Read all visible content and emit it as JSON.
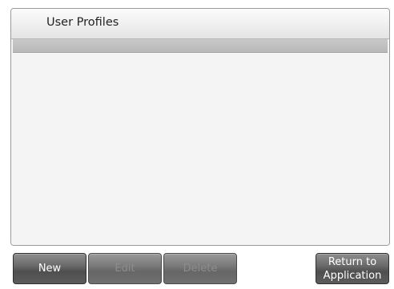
{
  "window": {
    "title": "User Profiles"
  },
  "buttons": {
    "new_label": "New",
    "edit_label": "Edit",
    "delete_label": "Delete",
    "return_label_line1": "Return to",
    "return_label_line2": "Application"
  },
  "state": {
    "edit_enabled": false,
    "delete_enabled": false
  }
}
